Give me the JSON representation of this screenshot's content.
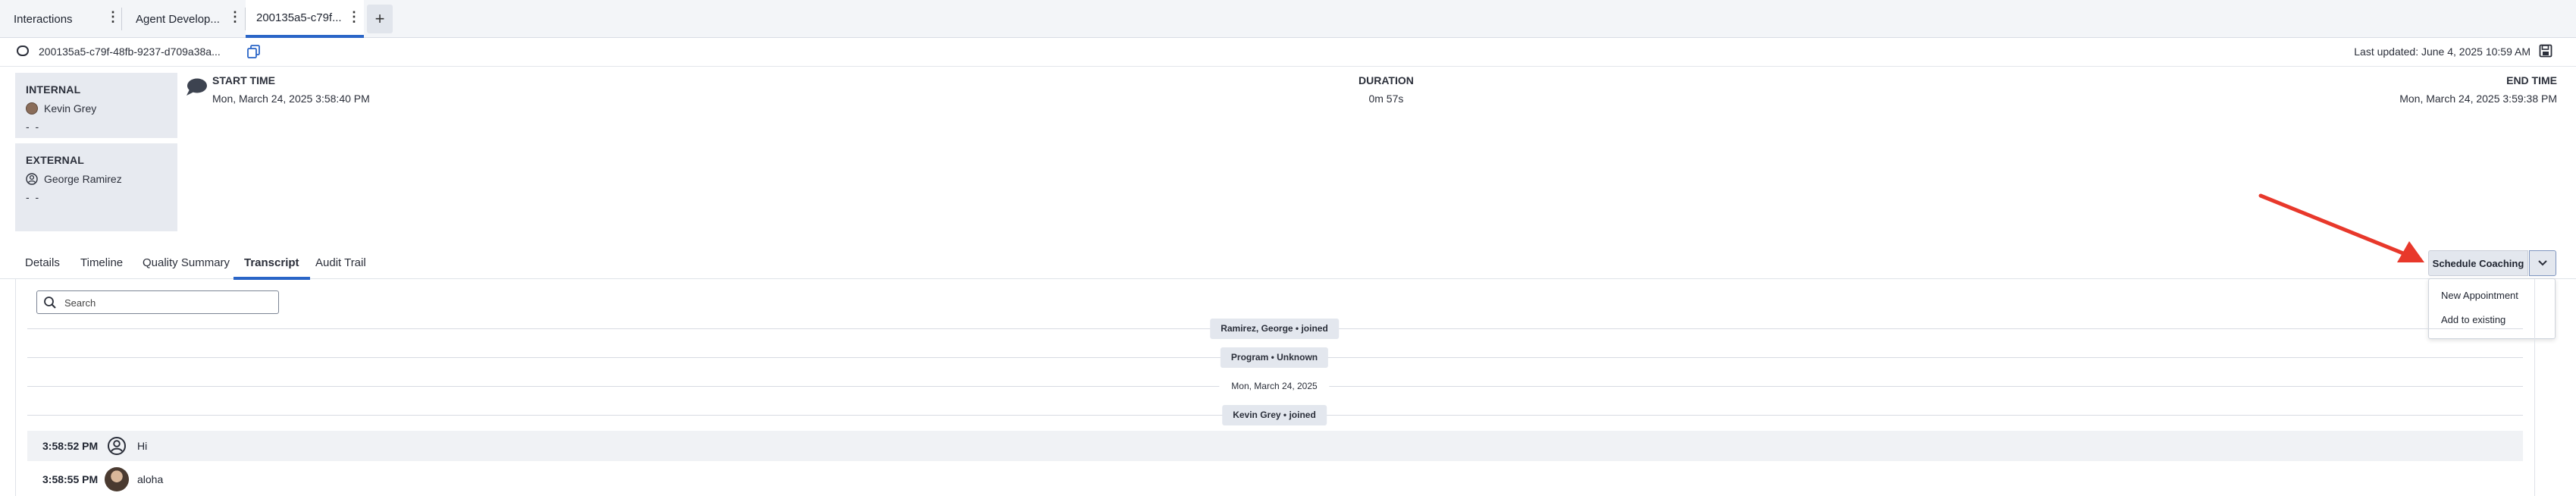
{
  "tabs": [
    {
      "label": "Interactions"
    },
    {
      "label": "Agent Develop..."
    },
    {
      "label": "200135a5-c79f..."
    }
  ],
  "conversation_id": "200135a5-c79f-48fb-9237-d709a38a...",
  "last_updated": "Last updated: June 4, 2025 10:59 AM",
  "participants": {
    "internal": {
      "type": "INTERNAL",
      "name": "Kevin Grey",
      "detail": "- -"
    },
    "external": {
      "type": "EXTERNAL",
      "name": "George Ramirez",
      "detail": "- -"
    }
  },
  "meta": {
    "start_label": "START TIME",
    "start_value": "Mon, March 24, 2025 3:58:40 PM",
    "duration_label": "DURATION",
    "duration_value": "0m 57s",
    "end_label": "END TIME",
    "end_value": "Mon, March 24, 2025 3:59:38 PM"
  },
  "detail_tabs": [
    "Details",
    "Timeline",
    "Quality Summary",
    "Transcript",
    "Audit Trail"
  ],
  "active_detail_tab": "Transcript",
  "schedule": {
    "button_label": "Schedule Coaching",
    "menu": [
      "New Appointment",
      "Add to existing"
    ]
  },
  "search": {
    "placeholder": "Search"
  },
  "transcript": {
    "events": [
      "Ramirez, George • joined",
      "Program • Unknown",
      "Mon, March 24, 2025",
      "Kevin Grey • joined"
    ],
    "messages": [
      {
        "time": "3:58:52 PM",
        "text": "Hi",
        "sender_icon": "user-circle-icon"
      },
      {
        "time": "3:58:55 PM",
        "text": "aloha",
        "sender_icon": "agent-avatar"
      }
    ]
  },
  "colors": {
    "accent": "#2a65c7",
    "annotation_arrow": "#e8382b"
  }
}
